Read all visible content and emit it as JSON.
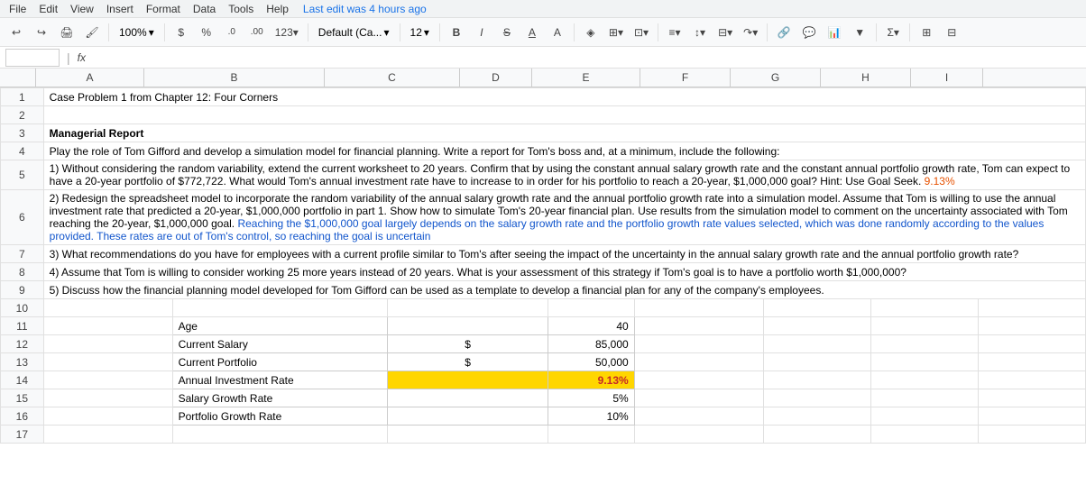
{
  "menubar": {
    "items": [
      "File",
      "Edit",
      "View",
      "Insert",
      "Format",
      "Data",
      "Tools",
      "Help"
    ],
    "last_edit": "Last edit was 4 hours ago"
  },
  "toolbar": {
    "zoom": "100%",
    "currency": "$",
    "percent": "%",
    "decimal0": ".0",
    "decimal00": ".00",
    "number_format": "123",
    "font": "Default (Ca...",
    "font_size": "12",
    "bold": "B",
    "italic": "I",
    "strikethrough": "S",
    "underline": "A"
  },
  "formula_bar": {
    "cell_ref": "fx"
  },
  "columns": {
    "headers": [
      "A",
      "B",
      "C",
      "D",
      "E",
      "F",
      "G",
      "H",
      "I"
    ]
  },
  "content": {
    "title": "Case Problem 1 from Chapter 12: Four Corners",
    "section_title": "Managerial Report",
    "paragraph1": "Play the role of Tom Gifford and develop a simulation model for financial planning. Write a report for Tom's boss and, at a minimum, include the following:",
    "item1_normal": "1) Without considering the random variability, extend the current worksheet to 20 years. Confirm that by using the constant annual salary growth rate and the constant annual portfolio growth rate, Tom can expect to have a 20-year portfolio of $772,722. What would Tom's annual investment rate have to increase to in order for his portfolio to reach a 20-year, $1,000,000 goal? ",
    "item1_hint": "Hint: Use Goal Seek. ",
    "item1_highlight": "9.13%",
    "item2_normal1": "2) Redesign the spreadsheet model to incorporate the random variability of the annual salary growth rate and the annual portfolio growth rate into a simulation model. Assume that Tom is willing to use the annual investment rate that predicted a 20-year, $1,000,000 portfolio in part 1. Show how to simulate Tom's 20-year financial plan. Use results from the simulation model to comment on the uncertainty associated with Tom reaching the 20-year, $1,000,000 goal. ",
    "item2_blue": "Reaching the $1,000,000 goal largely depends on the salary growth rate and the portfolio growth rate values selected, which was done randomly according to the values provided. These rates are out of Tom's control, so reaching the goal is uncertain",
    "item3": "3) What recommendations do you have for employees with a current profile similar to Tom's after seeing the impact of the uncertainty in the annual salary growth rate and the annual portfolio growth rate?",
    "item4": "4) Assume that Tom is willing to consider working 25 more years instead of 20 years. What is your assessment of this strategy if Tom's goal is to have a portfolio worth $1,000,000?",
    "item5": "5) Discuss how the financial planning model developed for Tom Gifford can be used as a template to develop a financial plan for any of the company's employees.",
    "table": {
      "rows": [
        {
          "label": "Age",
          "symbol": "",
          "value": "40"
        },
        {
          "label": "Current Salary",
          "symbol": "$",
          "value": "85,000"
        },
        {
          "label": "Current Portfolio",
          "symbol": "$",
          "value": "50,000"
        },
        {
          "label": "Annual Investment Rate",
          "symbol": "",
          "value": "9.13%",
          "highlight": true
        },
        {
          "label": "Salary Growth Rate",
          "symbol": "",
          "value": "5%"
        },
        {
          "label": "Portfolio Growth Rate",
          "symbol": "",
          "value": "10%"
        }
      ]
    }
  }
}
